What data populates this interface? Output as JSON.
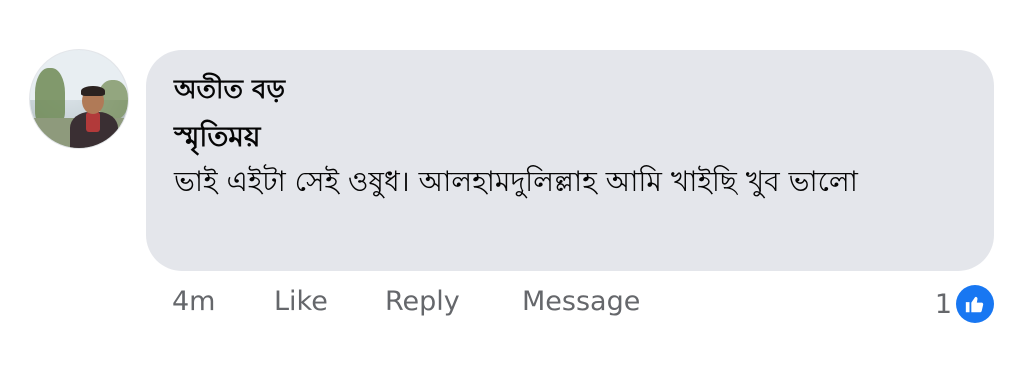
{
  "comment": {
    "author": "অতীত বড়",
    "text_line1": "স্মৃতিময়",
    "text_line2": "ভাই এইটা সেই ওষুধ। আলহামদুলিল্লাহ আমি খাইছি খুব ভালো"
  },
  "actions": {
    "time": "4m",
    "like": "Like",
    "reply": "Reply",
    "message": "Message"
  },
  "reactions": {
    "count": "1",
    "icon": "thumbs-up-icon",
    "color": "#1877f2"
  },
  "colors": {
    "bubble": "#e4e6eb",
    "meta_text": "#65676b",
    "text": "#050505"
  }
}
